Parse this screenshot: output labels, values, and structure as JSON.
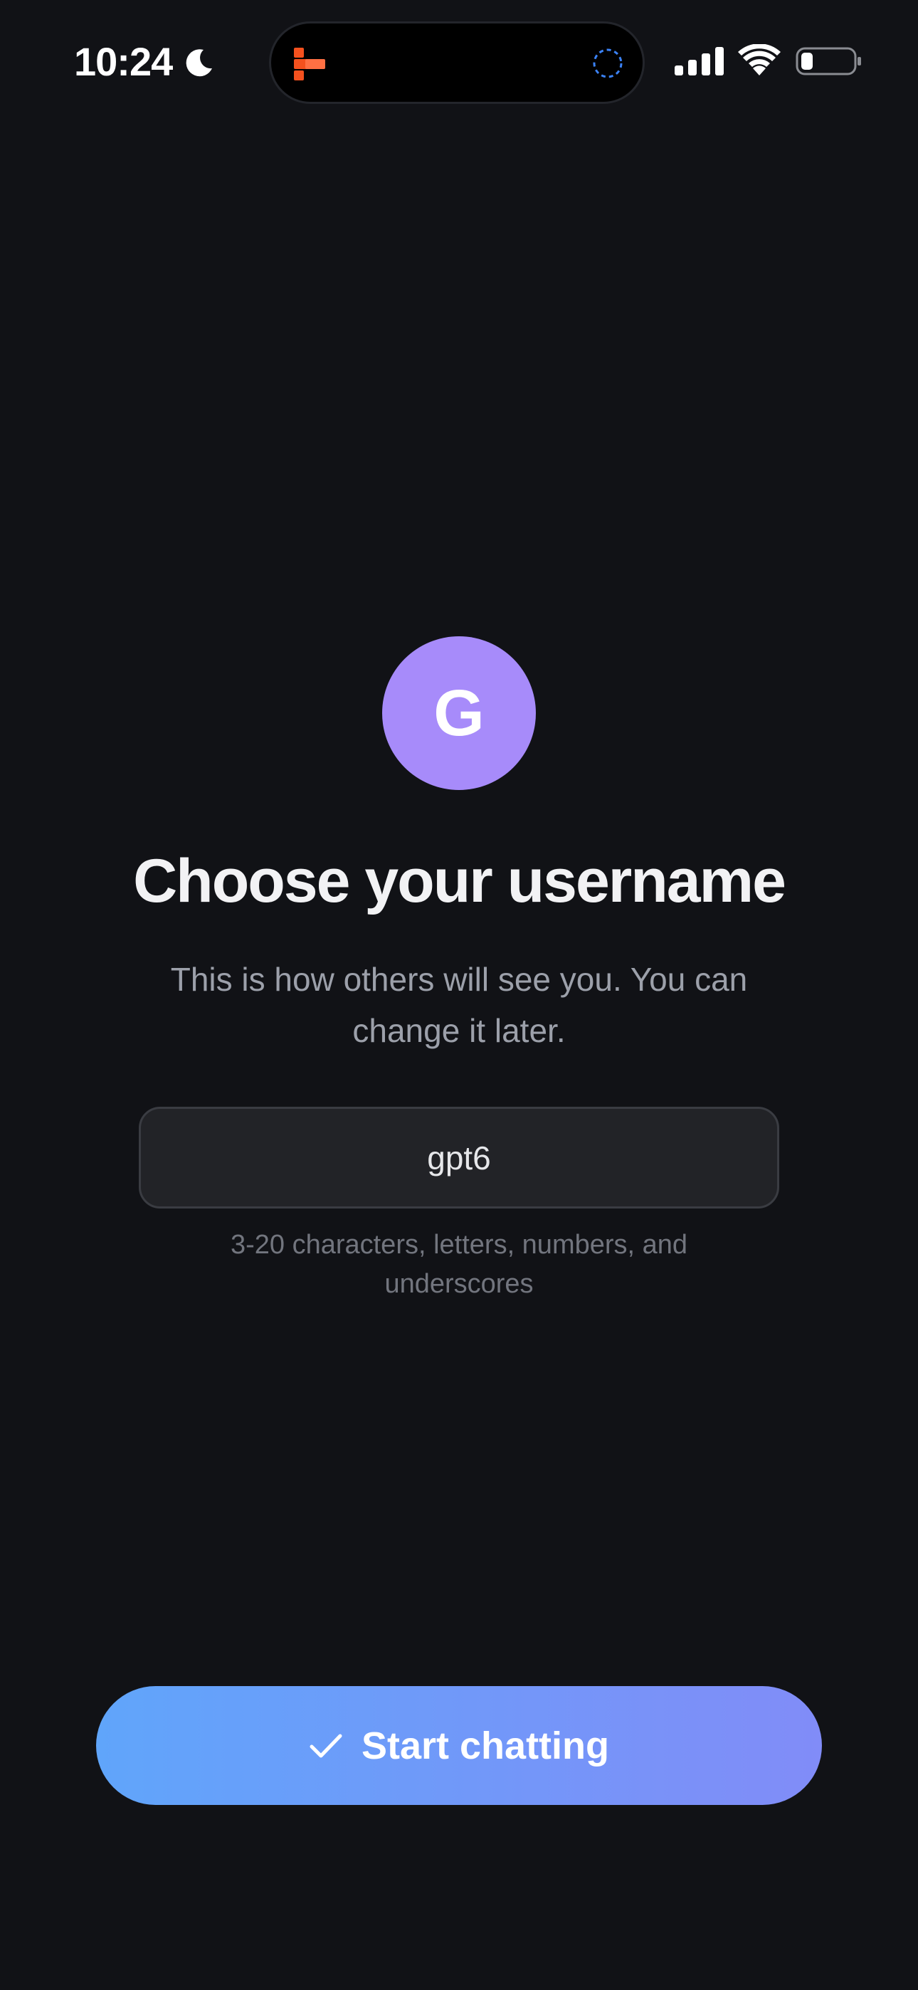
{
  "status_bar": {
    "time": "10:24",
    "icons": [
      "moon-icon",
      "app-activity-icon",
      "loading-icon",
      "signal-icon",
      "wifi-icon",
      "battery-icon"
    ],
    "battery_level": 0.2
  },
  "profile": {
    "avatar_letter": "G",
    "avatar_color": "#a78bfa"
  },
  "main": {
    "title": "Choose your username",
    "subtitle": "This is how others will see you. You can change it later.",
    "username_value": "gpt6",
    "helper_text": "3-20 characters, letters, numbers, and underscores"
  },
  "actions": {
    "start_label": "Start chatting",
    "start_icon": "check-icon"
  },
  "colors": {
    "background": "#111216",
    "accent_start": "#60a5fa",
    "accent_end": "#818cf8"
  }
}
